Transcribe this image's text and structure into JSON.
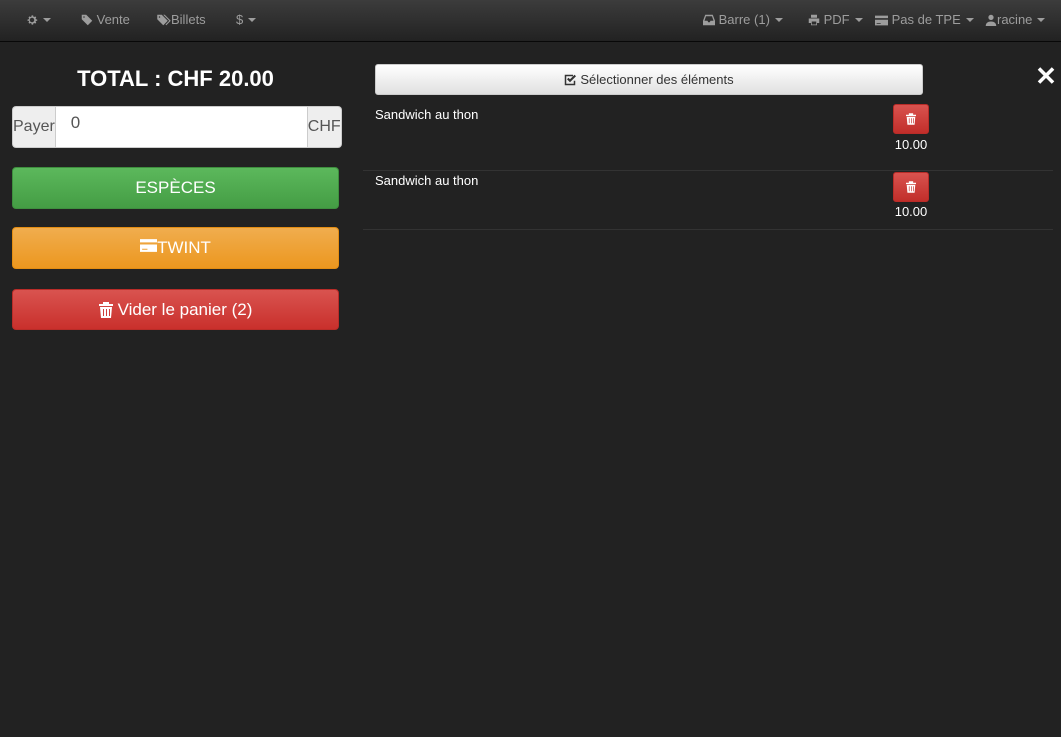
{
  "navbar": {
    "settings_icon": "cog-icon",
    "vente_label": "Vente",
    "billets_label": "Billets",
    "dollar_label": "$",
    "barre_label": "Barre (1)",
    "pdf_label": "PDF",
    "tpe_label": "Pas de TPE",
    "user_label": "racine"
  },
  "payment": {
    "total_label": "TOTAL : CHF 20.00",
    "pay_addon": "Payer",
    "pay_value": "0",
    "currency_addon": "CHF",
    "cash_label": "ESPÈCES",
    "twint_label": "TWINT",
    "clear_label": "Vider le panier (2)"
  },
  "cart": {
    "select_label": "Sélectionner des éléments",
    "close_label": "✕",
    "items": [
      {
        "name": "Sandwich au thon",
        "price": "10.00"
      },
      {
        "name": "Sandwich au thon",
        "price": "10.00"
      }
    ]
  },
  "colors": {
    "background": "#222222",
    "success": "#5cb85c",
    "warning": "#f0ad4e",
    "danger": "#d9534f"
  }
}
